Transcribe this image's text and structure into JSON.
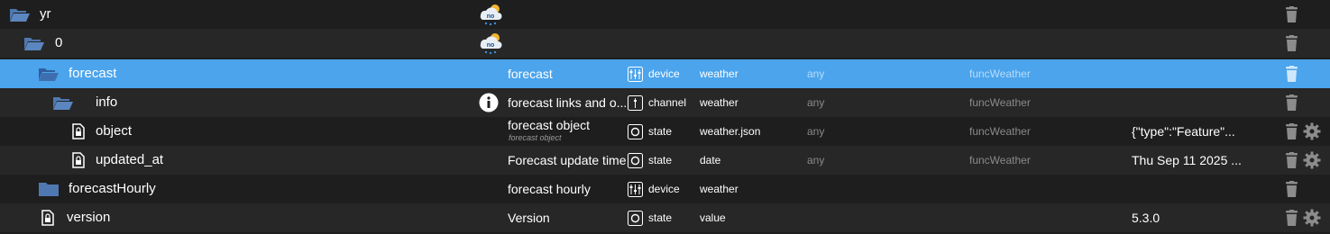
{
  "rows": [
    {
      "name": "yr",
      "icon": "folder-open-icon"
    },
    {
      "name": "0",
      "icon": "folder-open-icon"
    },
    {
      "name": "forecast",
      "icon": "folder-open-icon",
      "obj_name": "forecast",
      "type": "device",
      "role": "weather",
      "room": "any",
      "func": "funcWeather",
      "selected": true
    },
    {
      "name": "info",
      "icon": "folder-open-icon",
      "obj_name": "forecast links and o...",
      "type": "channel",
      "role": "weather",
      "room": "any",
      "func": "funcWeather"
    },
    {
      "name": "object",
      "icon": "file-lock-icon",
      "obj_name": "forecast object",
      "obj_subname": "forecast object",
      "type": "state",
      "role": "weather.json",
      "room": "any",
      "func": "funcWeather",
      "value": "{\"type\":\"Feature\"..."
    },
    {
      "name": "updated_at",
      "icon": "file-lock-icon",
      "obj_name": "Forecast update time",
      "type": "state",
      "role": "date",
      "room": "any",
      "func": "funcWeather",
      "value": "Thu Sep 11 2025 ..."
    },
    {
      "name": "forecastHourly",
      "icon": "folder-closed-icon",
      "obj_name": "forecast hourly",
      "type": "device",
      "role": "weather"
    },
    {
      "name": "version",
      "icon": "file-lock-icon",
      "obj_name": "Version",
      "type": "state",
      "role": "value",
      "value": "5.3.0"
    }
  ],
  "logo_text": "no",
  "colors": {
    "background": "#1e1e1e",
    "row_alt": "#272727",
    "selected": "#4ba4ec",
    "folder": "#4f78b0",
    "muted": "#8a8a8a"
  }
}
